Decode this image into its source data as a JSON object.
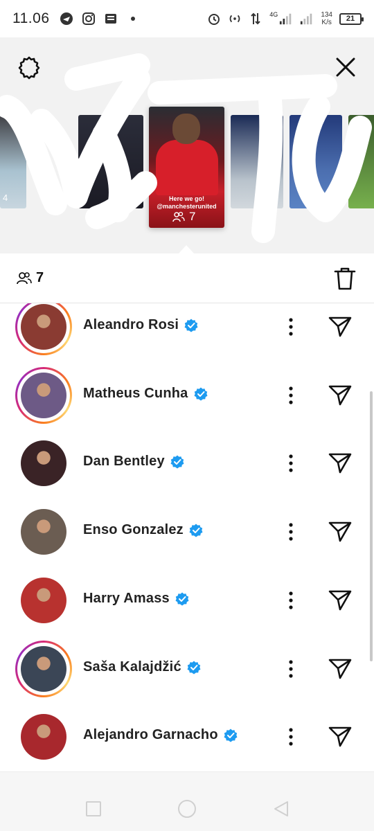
{
  "status_bar": {
    "time": "11.06",
    "network_type": "4G",
    "speed_value": "134",
    "speed_unit": "K/s",
    "battery": "21"
  },
  "story": {
    "caption_line1": "Here we go!",
    "caption_line2": "@manchesterunited",
    "viewer_count": "7",
    "left_thumb_number": "4"
  },
  "viewers_header": {
    "count": "7"
  },
  "viewers": [
    {
      "name": "Aleandro Rosi",
      "ring": true,
      "pic_color": "#8a3b32",
      "verified": true
    },
    {
      "name": "Matheus Cunha",
      "ring": true,
      "pic_color": "#6d5a86",
      "verified": true
    },
    {
      "name": "Dan Bentley",
      "ring": false,
      "pic_color": "#3a2326",
      "verified": true
    },
    {
      "name": "Enso Gonzalez",
      "ring": false,
      "pic_color": "#6b5d52",
      "verified": true
    },
    {
      "name": "Harry Amass",
      "ring": false,
      "pic_color": "#b8322f",
      "verified": true
    },
    {
      "name": "Saša Kalajdžić",
      "ring": true,
      "pic_color": "#3b4656",
      "verified": true
    },
    {
      "name": "Alejandro Garnacho",
      "ring": false,
      "pic_color": "#a8282d",
      "verified": true
    }
  ],
  "colors": {
    "verified_blue": "#1d9bf0",
    "ring_start": "#d62976",
    "ring_end": "#fa7e1e"
  }
}
